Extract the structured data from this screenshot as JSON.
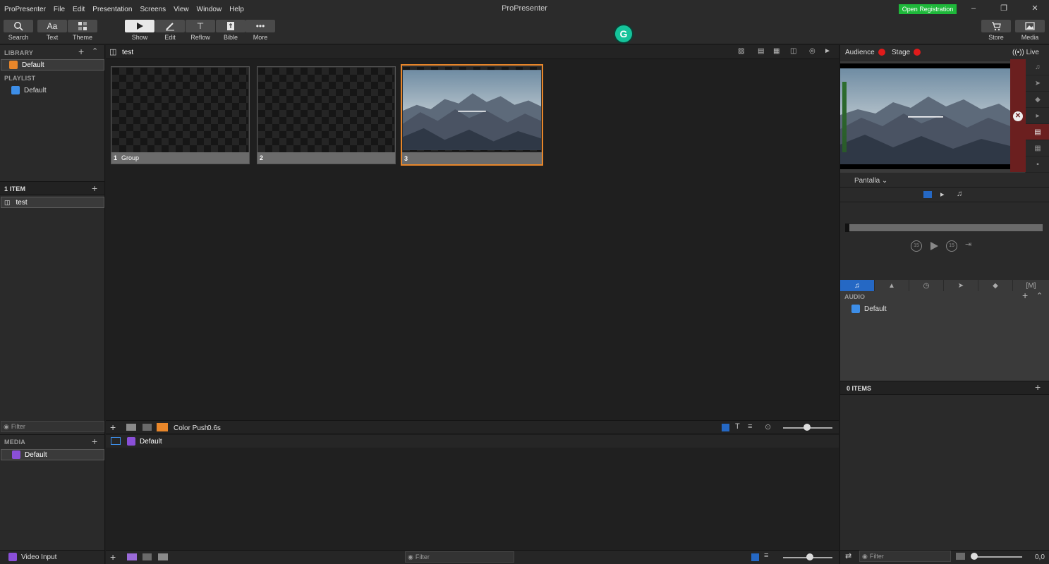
{
  "menubar": {
    "items": [
      "ProPresenter",
      "File",
      "Edit",
      "Presentation",
      "Screens",
      "View",
      "Window",
      "Help"
    ],
    "title": "ProPresenter",
    "open_registration": "Open Registration"
  },
  "toolbar": {
    "search": "Search",
    "text": "Text",
    "theme": "Theme",
    "show": "Show",
    "edit": "Edit",
    "reflow": "Reflow",
    "bible": "Bible",
    "more": "More",
    "store": "Store",
    "media": "Media"
  },
  "left": {
    "library_header": "LIBRARY",
    "library_item": "Default",
    "playlist_header": "PLAYLIST",
    "playlist_item": "Default",
    "items_header": "1 ITEM",
    "item": "test",
    "filter_placeholder": "Filter",
    "media_header": "MEDIA",
    "media_item": "Default",
    "video_input": "Video Input"
  },
  "center": {
    "presentation_title": "test",
    "slides": [
      {
        "number": "1",
        "group": "Group"
      },
      {
        "number": "2",
        "group": ""
      },
      {
        "number": "3",
        "group": ""
      }
    ],
    "transition": "Color Push",
    "transition_duration": "0.6s",
    "media_playlist": "Default",
    "bottom_filter": "Filter"
  },
  "right": {
    "audience": "Audience",
    "stage": "Stage",
    "live": "Live",
    "screen_select": "Pantalla",
    "skip_back": "15",
    "skip_fwd": "15",
    "audio_header": "AUDIO",
    "audio_item": "Default",
    "items_count": "0 ITEMS",
    "filter_placeholder": "Filter",
    "volume_value": "0,0"
  },
  "colors": {
    "accent": "#2568c4",
    "selection": "#e8862a",
    "record_red": "#e01b1b",
    "registration_green": "#1eb83a"
  }
}
